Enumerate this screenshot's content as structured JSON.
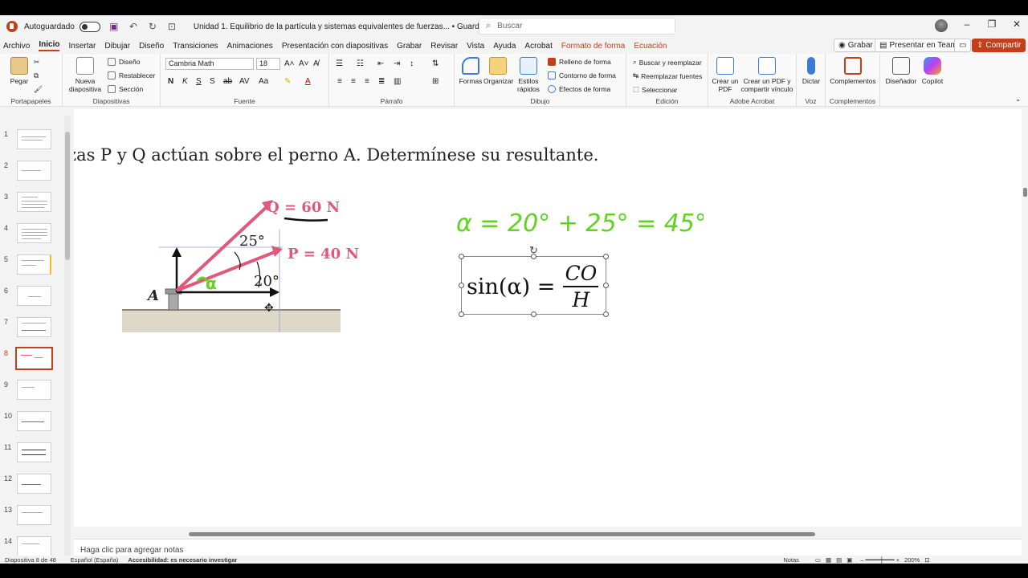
{
  "title_bar": {
    "autosave_label": "Autoguardado",
    "doc_title": "Unidad 1. Equilibrio de la partícula y sistemas equivalentes de fuerzas... • Guardado en Este PC ⌄",
    "search_placeholder": "Buscar"
  },
  "menu": {
    "tabs": [
      "Archivo",
      "Inicio",
      "Insertar",
      "Dibujar",
      "Diseño",
      "Transiciones",
      "Animaciones",
      "Presentación con diapositivas",
      "Grabar",
      "Revisar",
      "Vista",
      "Ayuda",
      "Acrobat",
      "Formato de forma",
      "Ecuación"
    ],
    "active_tab": "Inicio",
    "record_label": "Grabar",
    "teams_label": "Presentar en Teams",
    "share_label": "Compartir"
  },
  "ribbon": {
    "clipboard": {
      "paste": "Pegar",
      "group": "Portapapeles"
    },
    "slides": {
      "new_slide": "Nueva diapositiva",
      "layout": "Diseño",
      "reset": "Restablecer",
      "section": "Sección",
      "group": "Diapositivas"
    },
    "font": {
      "family": "Cambria Math",
      "size": "18",
      "group": "Fuente"
    },
    "paragraph": {
      "group": "Párrafo"
    },
    "drawing": {
      "shapes": "Formas",
      "arrange": "Organizar",
      "quick_styles": "Estilos rápidos",
      "fill": "Relleno de forma",
      "outline": "Contorno de forma",
      "effects": "Efectos de forma",
      "group": "Dibujo"
    },
    "editing": {
      "find": "Buscar y reemplazar",
      "replace_fonts": "Reemplazar fuentes",
      "select": "Seleccionar",
      "group": "Edición"
    },
    "acrobat": {
      "create_pdf": "Crear un PDF",
      "create_share": "Crear un PDF y compartir vínculo",
      "group": "Adobe Acrobat"
    },
    "voice": {
      "dictate": "Dictar",
      "group": "Voz"
    },
    "addins": {
      "addins": "Complementos",
      "group": "Complementos"
    },
    "designer": "Diseñador",
    "copilot": "Copilot"
  },
  "thumbnails": [
    "1",
    "2",
    "3",
    "4",
    "5",
    "6",
    "7",
    "8",
    "9",
    "10",
    "11",
    "12",
    "13",
    "14"
  ],
  "active_slide": "8",
  "slide": {
    "title": "zas P y Q actúan sobre el perno A. Determínese su resultante.",
    "q_label": "Q = 60 N",
    "p_label": "P = 40 N",
    "angle_25": "25°",
    "angle_20": "20°",
    "point_a": "A",
    "alpha_mark": "α",
    "handwritten_eq": "α = 20° + 25° = 45°",
    "equation": {
      "lhs": "sin(α) =",
      "numerator": "CO",
      "denominator": "H"
    }
  },
  "notes_placeholder": "Haga clic para agregar notas",
  "status": {
    "slide_info": "Diapositiva 8 de 48",
    "language": "Español (España)",
    "accessibility": "Accesibilidad: es necesario investigar",
    "notes": "Notas",
    "zoom": "200%"
  },
  "colors": {
    "accent": "#c43e1c",
    "vector_pink": "#e0587a",
    "handwriting_green": "#5fd31f"
  }
}
